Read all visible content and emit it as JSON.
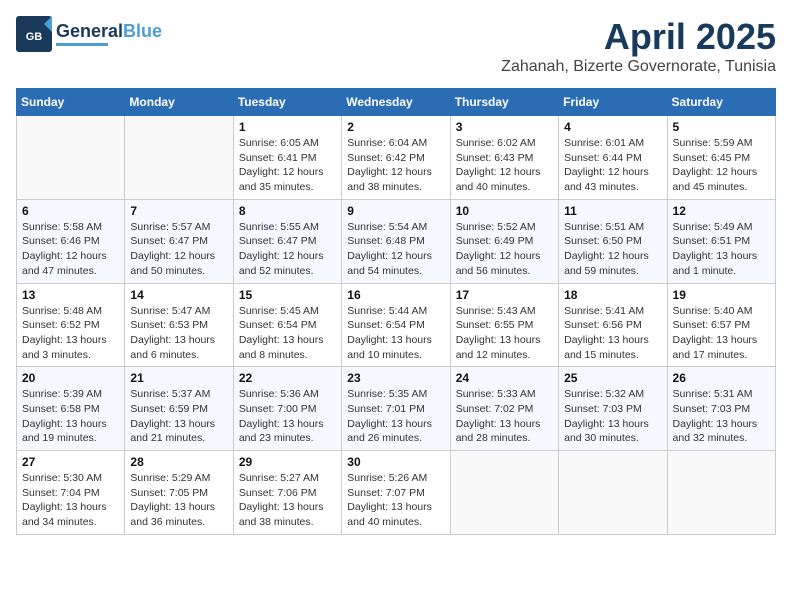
{
  "header": {
    "logo_line1": "General",
    "logo_line2": "Blue",
    "month": "April 2025",
    "location": "Zahanah, Bizerte Governorate, Tunisia"
  },
  "weekdays": [
    "Sunday",
    "Monday",
    "Tuesday",
    "Wednesday",
    "Thursday",
    "Friday",
    "Saturday"
  ],
  "weeks": [
    [
      {
        "day": "",
        "info": ""
      },
      {
        "day": "",
        "info": ""
      },
      {
        "day": "1",
        "info": "Sunrise: 6:05 AM\nSunset: 6:41 PM\nDaylight: 12 hours and 35 minutes."
      },
      {
        "day": "2",
        "info": "Sunrise: 6:04 AM\nSunset: 6:42 PM\nDaylight: 12 hours and 38 minutes."
      },
      {
        "day": "3",
        "info": "Sunrise: 6:02 AM\nSunset: 6:43 PM\nDaylight: 12 hours and 40 minutes."
      },
      {
        "day": "4",
        "info": "Sunrise: 6:01 AM\nSunset: 6:44 PM\nDaylight: 12 hours and 43 minutes."
      },
      {
        "day": "5",
        "info": "Sunrise: 5:59 AM\nSunset: 6:45 PM\nDaylight: 12 hours and 45 minutes."
      }
    ],
    [
      {
        "day": "6",
        "info": "Sunrise: 5:58 AM\nSunset: 6:46 PM\nDaylight: 12 hours and 47 minutes."
      },
      {
        "day": "7",
        "info": "Sunrise: 5:57 AM\nSunset: 6:47 PM\nDaylight: 12 hours and 50 minutes."
      },
      {
        "day": "8",
        "info": "Sunrise: 5:55 AM\nSunset: 6:47 PM\nDaylight: 12 hours and 52 minutes."
      },
      {
        "day": "9",
        "info": "Sunrise: 5:54 AM\nSunset: 6:48 PM\nDaylight: 12 hours and 54 minutes."
      },
      {
        "day": "10",
        "info": "Sunrise: 5:52 AM\nSunset: 6:49 PM\nDaylight: 12 hours and 56 minutes."
      },
      {
        "day": "11",
        "info": "Sunrise: 5:51 AM\nSunset: 6:50 PM\nDaylight: 12 hours and 59 minutes."
      },
      {
        "day": "12",
        "info": "Sunrise: 5:49 AM\nSunset: 6:51 PM\nDaylight: 13 hours and 1 minute."
      }
    ],
    [
      {
        "day": "13",
        "info": "Sunrise: 5:48 AM\nSunset: 6:52 PM\nDaylight: 13 hours and 3 minutes."
      },
      {
        "day": "14",
        "info": "Sunrise: 5:47 AM\nSunset: 6:53 PM\nDaylight: 13 hours and 6 minutes."
      },
      {
        "day": "15",
        "info": "Sunrise: 5:45 AM\nSunset: 6:54 PM\nDaylight: 13 hours and 8 minutes."
      },
      {
        "day": "16",
        "info": "Sunrise: 5:44 AM\nSunset: 6:54 PM\nDaylight: 13 hours and 10 minutes."
      },
      {
        "day": "17",
        "info": "Sunrise: 5:43 AM\nSunset: 6:55 PM\nDaylight: 13 hours and 12 minutes."
      },
      {
        "day": "18",
        "info": "Sunrise: 5:41 AM\nSunset: 6:56 PM\nDaylight: 13 hours and 15 minutes."
      },
      {
        "day": "19",
        "info": "Sunrise: 5:40 AM\nSunset: 6:57 PM\nDaylight: 13 hours and 17 minutes."
      }
    ],
    [
      {
        "day": "20",
        "info": "Sunrise: 5:39 AM\nSunset: 6:58 PM\nDaylight: 13 hours and 19 minutes."
      },
      {
        "day": "21",
        "info": "Sunrise: 5:37 AM\nSunset: 6:59 PM\nDaylight: 13 hours and 21 minutes."
      },
      {
        "day": "22",
        "info": "Sunrise: 5:36 AM\nSunset: 7:00 PM\nDaylight: 13 hours and 23 minutes."
      },
      {
        "day": "23",
        "info": "Sunrise: 5:35 AM\nSunset: 7:01 PM\nDaylight: 13 hours and 26 minutes."
      },
      {
        "day": "24",
        "info": "Sunrise: 5:33 AM\nSunset: 7:02 PM\nDaylight: 13 hours and 28 minutes."
      },
      {
        "day": "25",
        "info": "Sunrise: 5:32 AM\nSunset: 7:03 PM\nDaylight: 13 hours and 30 minutes."
      },
      {
        "day": "26",
        "info": "Sunrise: 5:31 AM\nSunset: 7:03 PM\nDaylight: 13 hours and 32 minutes."
      }
    ],
    [
      {
        "day": "27",
        "info": "Sunrise: 5:30 AM\nSunset: 7:04 PM\nDaylight: 13 hours and 34 minutes."
      },
      {
        "day": "28",
        "info": "Sunrise: 5:29 AM\nSunset: 7:05 PM\nDaylight: 13 hours and 36 minutes."
      },
      {
        "day": "29",
        "info": "Sunrise: 5:27 AM\nSunset: 7:06 PM\nDaylight: 13 hours and 38 minutes."
      },
      {
        "day": "30",
        "info": "Sunrise: 5:26 AM\nSunset: 7:07 PM\nDaylight: 13 hours and 40 minutes."
      },
      {
        "day": "",
        "info": ""
      },
      {
        "day": "",
        "info": ""
      },
      {
        "day": "",
        "info": ""
      }
    ]
  ]
}
